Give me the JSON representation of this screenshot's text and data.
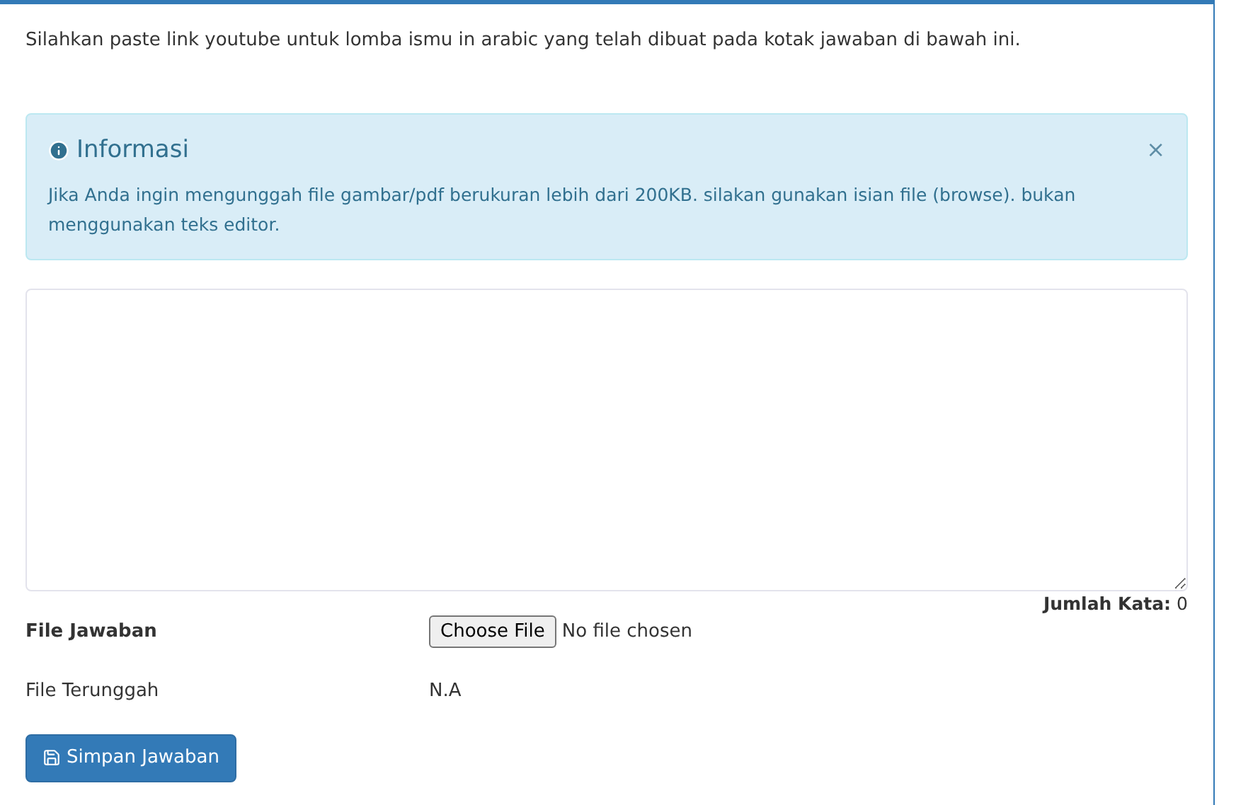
{
  "instruction": "Silahkan paste link youtube untuk lomba ismu in arabic yang telah dibuat pada kotak jawaban di bawah ini.",
  "alert": {
    "title": "Informasi",
    "message": "Jika Anda ingin mengunggah file gambar/pdf berukuran lebih dari 200KB. silakan gunakan isian file (browse). bukan menggunakan teks editor.",
    "close": "×"
  },
  "word_count": {
    "label": "Jumlah Kata:",
    "value": "0"
  },
  "file_field": {
    "label": "File Jawaban",
    "button": "Choose File",
    "status": "No file chosen"
  },
  "uploaded": {
    "label": "File Terunggah",
    "value": "N.A"
  },
  "submit": "Simpan Jawaban"
}
